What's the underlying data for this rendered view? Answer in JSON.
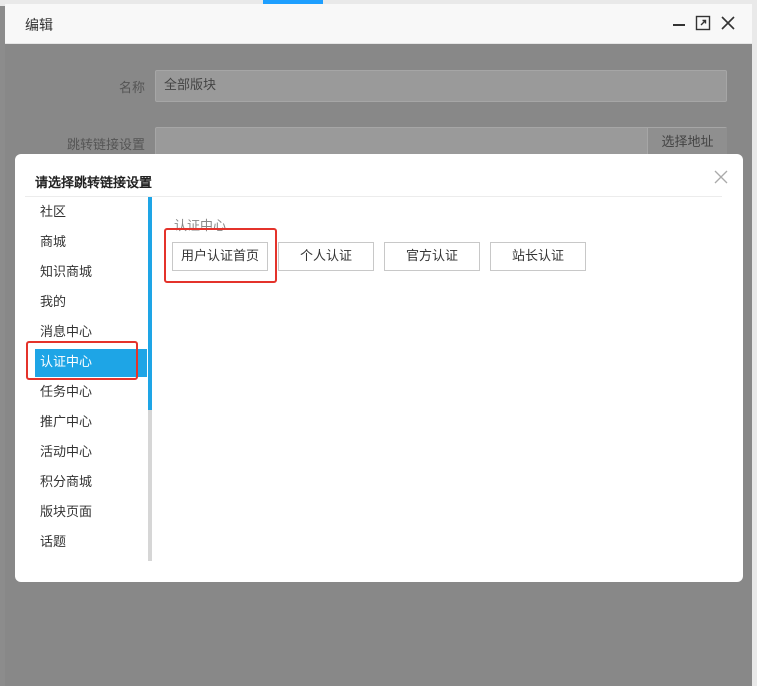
{
  "outer_dialog": {
    "title": "编辑",
    "fields": [
      {
        "label": "名称",
        "value": "全部版块"
      },
      {
        "label": "跳转链接设置",
        "value": "",
        "button": "选择地址"
      }
    ]
  },
  "link_dialog": {
    "title": "请选择跳转链接设置",
    "sidebar": [
      {
        "label": "社区"
      },
      {
        "label": "商城"
      },
      {
        "label": "知识商城"
      },
      {
        "label": "我的"
      },
      {
        "label": "消息中心"
      },
      {
        "label": "认证中心",
        "active": true
      },
      {
        "label": "任务中心"
      },
      {
        "label": "推广中心"
      },
      {
        "label": "活动中心"
      },
      {
        "label": "积分商城"
      },
      {
        "label": "版块页面"
      },
      {
        "label": "话题"
      }
    ],
    "section_label": "认证中心",
    "options": [
      "用户认证首页",
      "个人认证",
      "官方认证",
      "站长认证"
    ]
  },
  "colors": {
    "accent": "#1ea5e6",
    "highlight": "#e4332b",
    "overlay": "#8c8c8c"
  }
}
